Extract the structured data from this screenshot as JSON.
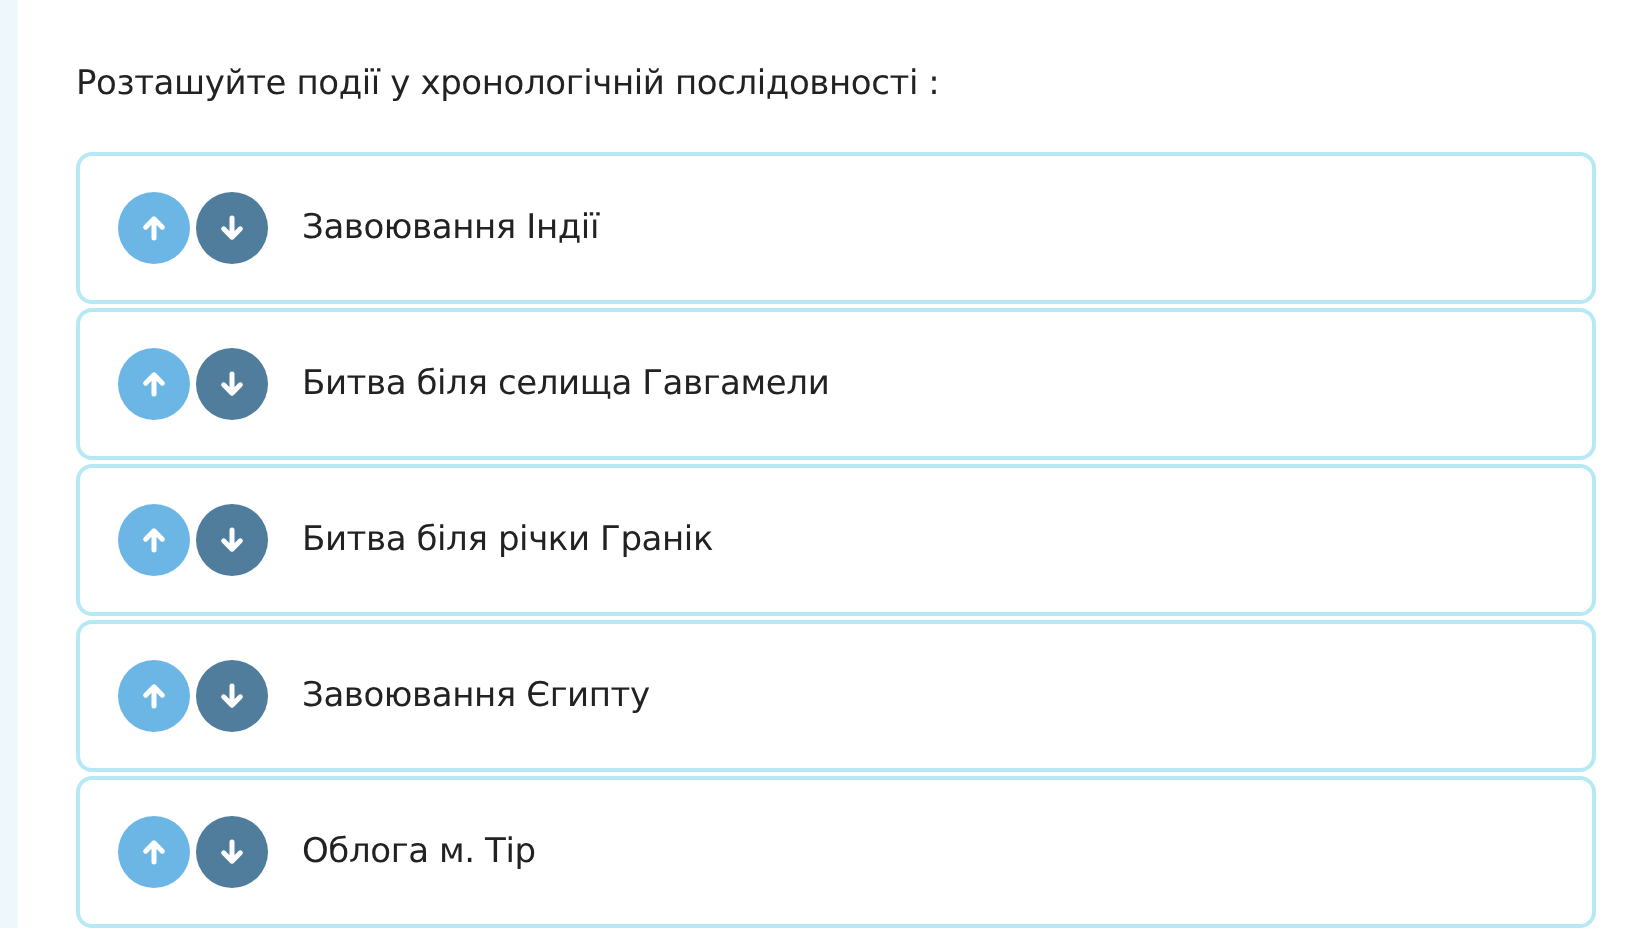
{
  "instruction": "Розташуйте події у хронологічній послідовності :",
  "items": [
    {
      "label": "Завоювання Індії"
    },
    {
      "label": "Битва біля селища Гавгамели"
    },
    {
      "label": "Битва біля річки Гранік"
    },
    {
      "label": "Завоювання Єгипту"
    },
    {
      "label": "Облога м. Тір"
    }
  ]
}
